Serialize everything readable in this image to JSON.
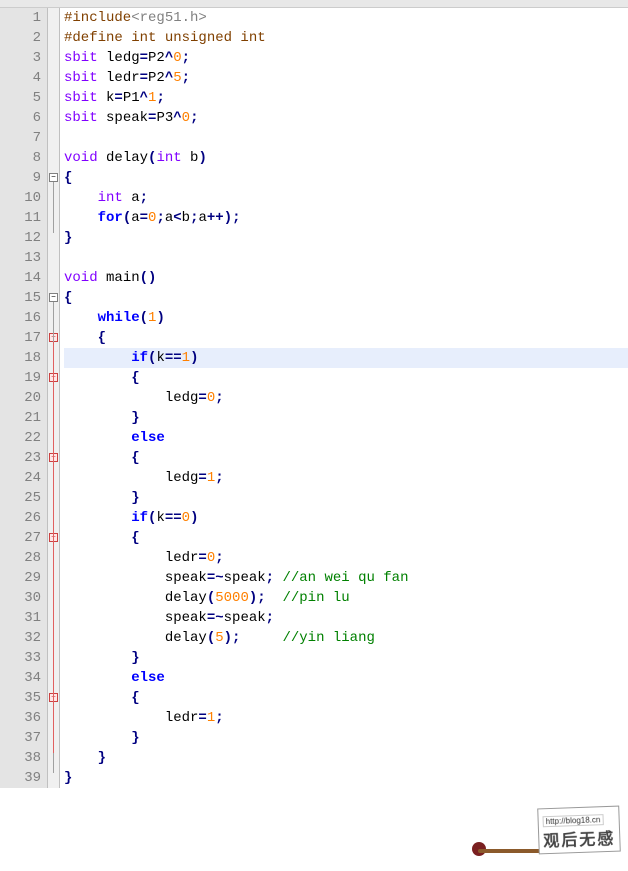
{
  "lines": [
    {
      "n": 1,
      "html": "<span class='p'>#include</span><span class='s'>&lt;reg51.h&gt;</span>"
    },
    {
      "n": 2,
      "html": "<span class='p'>#define int unsigned int</span>"
    },
    {
      "n": 3,
      "html": "<span class='t'>sbit</span> ledg<span class='op'>=</span>P2<span class='op'>^</span><span class='n'>0</span><span class='op'>;</span>"
    },
    {
      "n": 4,
      "html": "<span class='t'>sbit</span> ledr<span class='op'>=</span>P2<span class='op'>^</span><span class='n'>5</span><span class='op'>;</span>"
    },
    {
      "n": 5,
      "html": "<span class='t'>sbit</span> k<span class='op'>=</span>P1<span class='op'>^</span><span class='n'>1</span><span class='op'>;</span>"
    },
    {
      "n": 6,
      "html": "<span class='t'>sbit</span> speak<span class='op'>=</span>P3<span class='op'>^</span><span class='n'>0</span><span class='op'>;</span>"
    },
    {
      "n": 7,
      "html": ""
    },
    {
      "n": 8,
      "html": "<span class='t'>void</span> delay<span class='br'>(</span><span class='t'>int</span> b<span class='br'>)</span>"
    },
    {
      "n": 9,
      "html": "<span class='br'>{</span>",
      "fold": "minus"
    },
    {
      "n": 10,
      "html": "    <span class='t'>int</span> a<span class='op'>;</span>"
    },
    {
      "n": 11,
      "html": "    <span class='k'>for</span><span class='br'>(</span>a<span class='op'>=</span><span class='n'>0</span><span class='op'>;</span>a<span class='op'>&lt;</span>b<span class='op'>;</span>a<span class='op'>++</span><span class='br'>)</span><span class='op'>;</span>"
    },
    {
      "n": 12,
      "html": "<span class='br'>}</span>"
    },
    {
      "n": 13,
      "html": ""
    },
    {
      "n": 14,
      "html": "<span class='t'>void</span> main<span class='br'>()</span>"
    },
    {
      "n": 15,
      "html": "<span class='br'>{</span>",
      "fold": "minus"
    },
    {
      "n": 16,
      "html": "    <span class='k'>while</span><span class='br'>(</span><span class='n'>1</span><span class='br'>)</span>"
    },
    {
      "n": 17,
      "html": "    <span class='br'>{</span>",
      "fold": "minus-red"
    },
    {
      "n": 18,
      "html": "        <span class='k'>if</span><span class='br'>(</span>k<span class='op'>==</span><span class='n'>1</span><span class='br'>)</span>",
      "hl": true
    },
    {
      "n": 19,
      "html": "        <span class='br'>{</span>",
      "fold": "minus-red"
    },
    {
      "n": 20,
      "html": "            ledg<span class='op'>=</span><span class='n'>0</span><span class='op'>;</span>"
    },
    {
      "n": 21,
      "html": "        <span class='br'>}</span>"
    },
    {
      "n": 22,
      "html": "        <span class='k'>else</span>"
    },
    {
      "n": 23,
      "html": "        <span class='br'>{</span>",
      "fold": "minus-red"
    },
    {
      "n": 24,
      "html": "            ledg<span class='op'>=</span><span class='n'>1</span><span class='op'>;</span>"
    },
    {
      "n": 25,
      "html": "        <span class='br'>}</span>"
    },
    {
      "n": 26,
      "html": "        <span class='k'>if</span><span class='br'>(</span>k<span class='op'>==</span><span class='n'>0</span><span class='br'>)</span>"
    },
    {
      "n": 27,
      "html": "        <span class='br'>{</span>",
      "fold": "minus-red"
    },
    {
      "n": 28,
      "html": "            ledr<span class='op'>=</span><span class='n'>0</span><span class='op'>;</span>"
    },
    {
      "n": 29,
      "html": "            speak<span class='op'>=~</span>speak<span class='op'>;</span> <span class='c'>//an wei qu fan</span>"
    },
    {
      "n": 30,
      "html": "            delay<span class='br'>(</span><span class='n'>5000</span><span class='br'>)</span><span class='op'>;</span>  <span class='c'>//pin lu</span>"
    },
    {
      "n": 31,
      "html": "            speak<span class='op'>=~</span>speak<span class='op'>;</span>"
    },
    {
      "n": 32,
      "html": "            delay<span class='br'>(</span><span class='n'>5</span><span class='br'>)</span><span class='op'>;</span>     <span class='c'>//yin liang</span>"
    },
    {
      "n": 33,
      "html": "        <span class='br'>}</span>"
    },
    {
      "n": 34,
      "html": "        <span class='k'>else</span>"
    },
    {
      "n": 35,
      "html": "        <span class='br'>{</span>",
      "fold": "minus-red"
    },
    {
      "n": 36,
      "html": "            ledr<span class='op'>=</span><span class='n'>1</span><span class='op'>;</span>"
    },
    {
      "n": 37,
      "html": "        <span class='br'>}</span>"
    },
    {
      "n": 38,
      "html": "    <span class='br'>}</span>"
    },
    {
      "n": 39,
      "html": "<span class='br'>}</span>"
    }
  ],
  "watermark": {
    "url": "http://blog18.cn",
    "text": "观后无感"
  }
}
